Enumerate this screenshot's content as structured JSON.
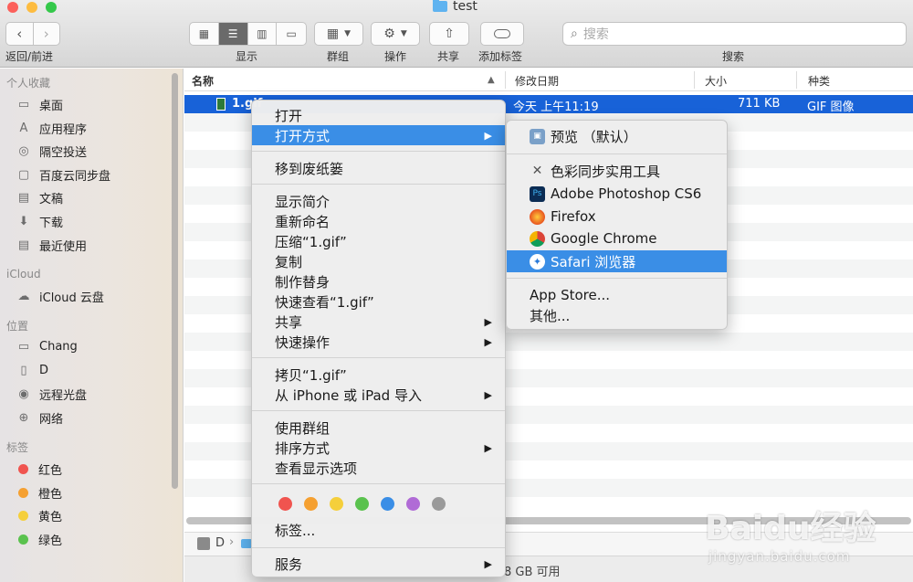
{
  "window": {
    "title": "test"
  },
  "toolbar": {
    "nav_label": "返回/前进",
    "view_label": "显示",
    "group_label": "群组",
    "action_label": "操作",
    "share_label": "共享",
    "tags_label": "添加标签",
    "search_label": "搜索",
    "search_placeholder": "搜索"
  },
  "sidebar": {
    "favorites_header": "个人收藏",
    "favorites": [
      {
        "label": "桌面",
        "icon": "desktop-icon"
      },
      {
        "label": "应用程序",
        "icon": "applications-icon"
      },
      {
        "label": "隔空投送",
        "icon": "airdrop-icon"
      },
      {
        "label": "百度云同步盘",
        "icon": "folder-icon"
      },
      {
        "label": "文稿",
        "icon": "documents-icon"
      },
      {
        "label": "下载",
        "icon": "downloads-icon"
      },
      {
        "label": "最近使用",
        "icon": "recents-icon"
      }
    ],
    "icloud_header": "iCloud",
    "icloud": [
      {
        "label": "iCloud 云盘",
        "icon": "cloud-icon"
      }
    ],
    "locations_header": "位置",
    "locations": [
      {
        "label": "Chang",
        "icon": "computer-icon"
      },
      {
        "label": "D",
        "icon": "disk-icon"
      },
      {
        "label": "远程光盘",
        "icon": "optical-disc-icon"
      },
      {
        "label": "网络",
        "icon": "network-icon"
      }
    ],
    "tags_header": "标签",
    "tags": [
      {
        "label": "红色",
        "color": "#f0544f"
      },
      {
        "label": "橙色",
        "color": "#f5a031"
      },
      {
        "label": "黄色",
        "color": "#f5cf3b"
      },
      {
        "label": "绿色",
        "color": "#5ac24e"
      }
    ]
  },
  "columns": {
    "name": "名称",
    "modified": "修改日期",
    "size": "大小",
    "kind": "种类"
  },
  "files": [
    {
      "name": "1.gif",
      "modified": "今天 上午11:19",
      "size": "711 KB",
      "kind": "GIF 图像"
    }
  ],
  "pathbar": {
    "disk": "D",
    "sep": "›"
  },
  "statusbar": {
    "free": "8 GB 可用"
  },
  "context_menu": {
    "open": "打开",
    "open_with": "打开方式",
    "trash": "移到废纸篓",
    "get_info": "显示简介",
    "rename": "重新命名",
    "compress": "压缩“1.gif”",
    "duplicate": "复制",
    "alias": "制作替身",
    "quick_look": "快速查看“1.gif”",
    "share": "共享",
    "quick_actions": "快速操作",
    "copy": "拷贝“1.gif”",
    "import": "从 iPhone 或 iPad 导入",
    "use_groups": "使用群组",
    "sort_by": "排序方式",
    "view_options": "查看显示选项",
    "tag_colors": [
      "#f0544f",
      "#f5a031",
      "#f5cf3b",
      "#5ac24e",
      "#3a8ee6",
      "#b06bd6",
      "#9a9a9a"
    ],
    "tags": "标签...",
    "services": "服务"
  },
  "open_with_menu": {
    "preview": "预览 （默认）",
    "colorsync": "色彩同步实用工具",
    "photoshop": "Adobe Photoshop CS6",
    "firefox": "Firefox",
    "chrome": "Google Chrome",
    "safari": "Safari 浏览器",
    "app_store": "App Store...",
    "other": "其他..."
  },
  "watermark": {
    "brand": "Baidu经验",
    "url": "jingyan.baidu.com"
  }
}
